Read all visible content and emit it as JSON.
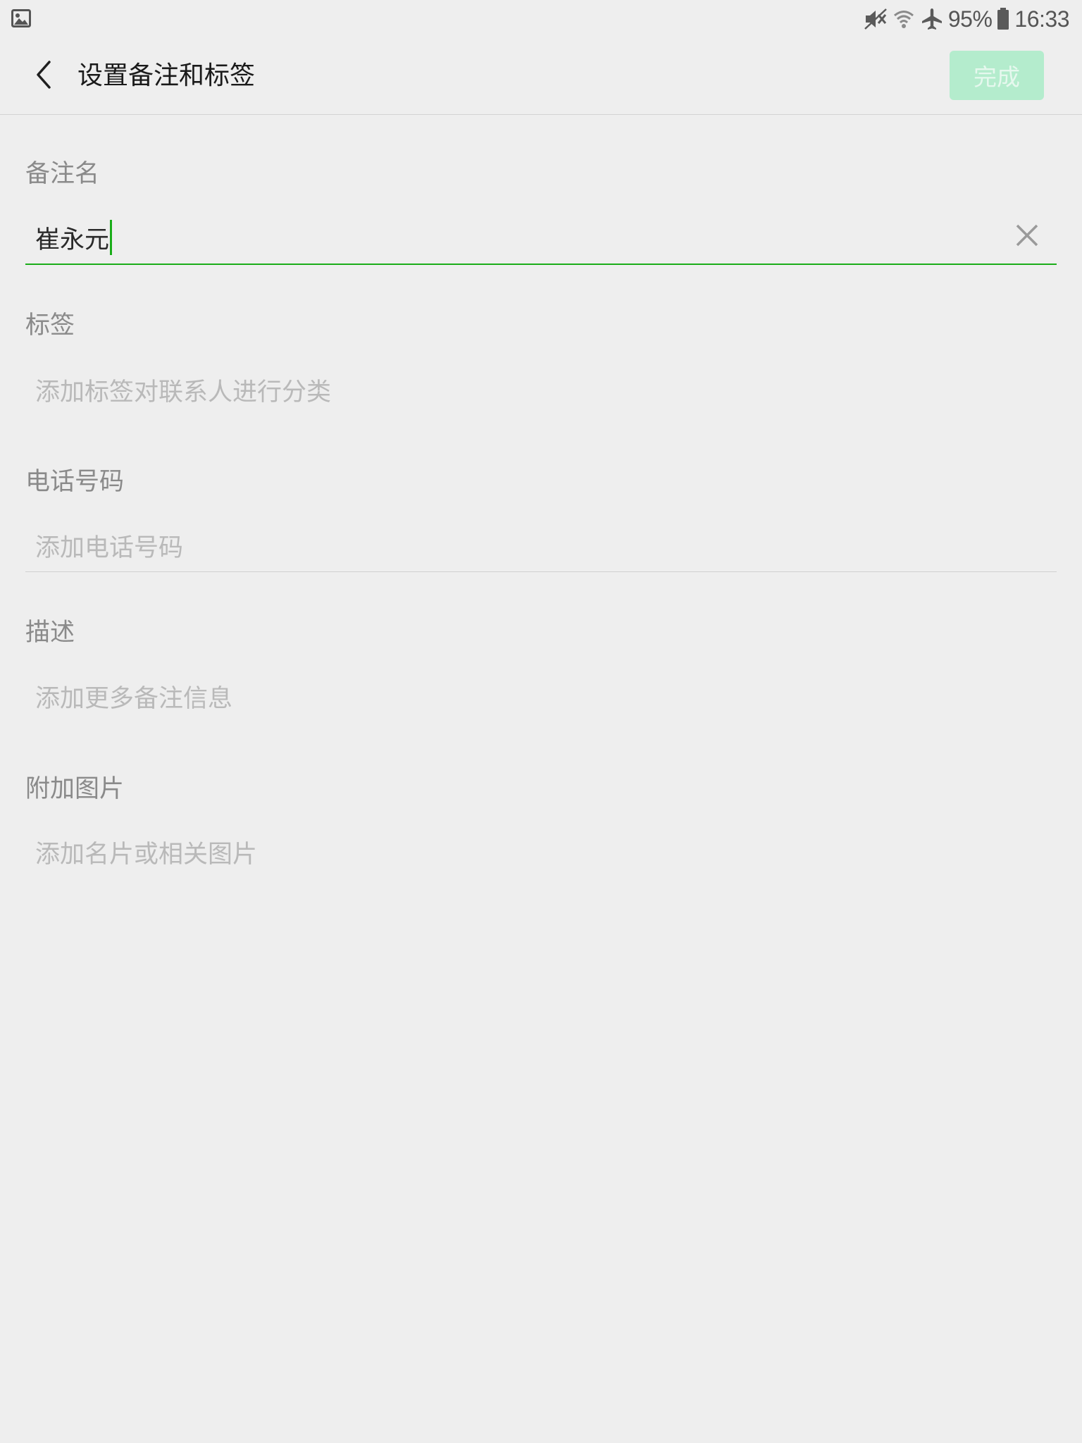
{
  "status_bar": {
    "left_icon": "gallery-icon",
    "icons": [
      "mute-icon",
      "wifi-icon",
      "airplane-icon",
      "battery-icon"
    ],
    "battery": "95%",
    "time": "16:33"
  },
  "header": {
    "back_icon": "chevron-left-icon",
    "title": "设置备注和标签",
    "done_label": "完成"
  },
  "form": {
    "remark": {
      "label": "备注名",
      "value": "崔永元",
      "clear_icon": "close-icon"
    },
    "tags": {
      "label": "标签",
      "placeholder": "添加标签对联系人进行分类"
    },
    "phone": {
      "label": "电话号码",
      "placeholder": "添加电话号码"
    },
    "description": {
      "label": "描述",
      "placeholder": "添加更多备注信息"
    },
    "photos": {
      "label": "附加图片",
      "placeholder": "添加名片或相关图片"
    }
  },
  "colors": {
    "background": "#eeeeee",
    "accent": "#1aad19",
    "done_button_disabled_bg": "#b4eccd",
    "label_gray": "#8a8a8a",
    "placeholder_gray": "#b9b9b9"
  }
}
